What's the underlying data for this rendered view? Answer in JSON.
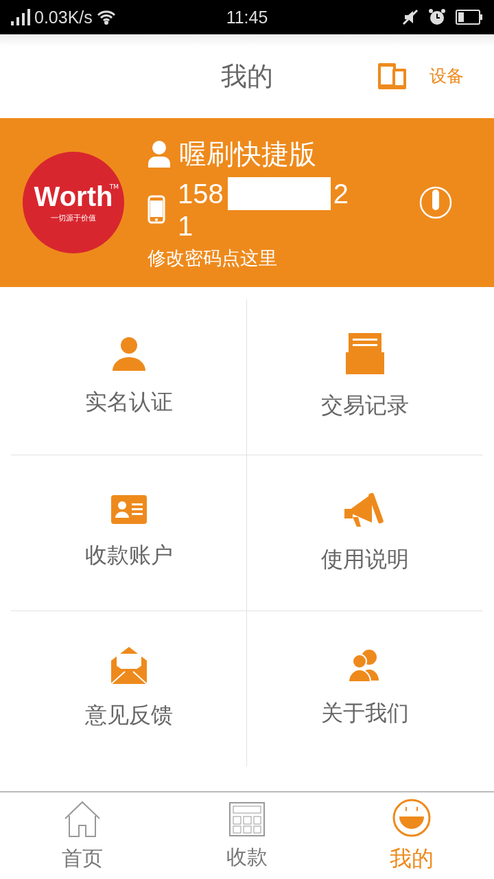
{
  "status_bar": {
    "speed": "0.03K/s",
    "time": "11:45"
  },
  "header": {
    "title": "我的",
    "device_label": "设备"
  },
  "profile": {
    "logo": {
      "word": "Worth",
      "tm": "TM",
      "slogan": "一切源于价值"
    },
    "name": "喔刷快捷版",
    "phone_start": "158",
    "phone_end": "2",
    "phone_line2": "1",
    "change_password": "修改密码点这里"
  },
  "menu": [
    {
      "kind": "person",
      "label": "实名认证"
    },
    {
      "kind": "records",
      "label": "交易记录"
    },
    {
      "kind": "card",
      "label": "收款账户"
    },
    {
      "kind": "megaphone",
      "label": "使用说明"
    },
    {
      "kind": "mail",
      "label": "意见反馈"
    },
    {
      "kind": "people",
      "label": "关于我们"
    }
  ],
  "tabs": [
    {
      "kind": "home",
      "label": "首页",
      "selected": false
    },
    {
      "kind": "calculator",
      "label": "收款",
      "selected": false
    },
    {
      "kind": "smile",
      "label": "我的",
      "selected": true
    }
  ]
}
